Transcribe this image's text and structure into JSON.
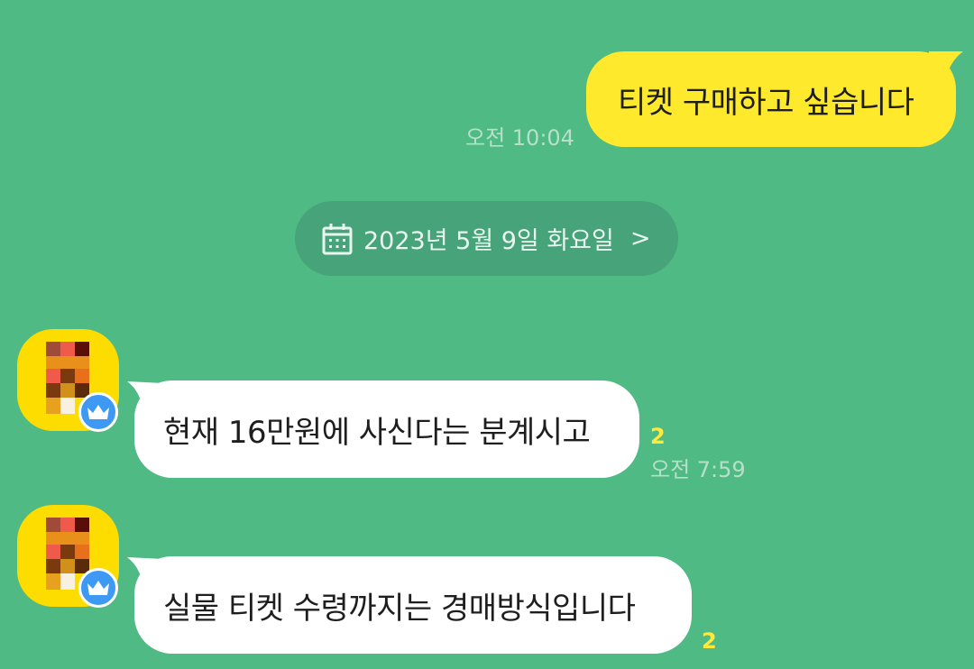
{
  "messages": {
    "outgoing_1": {
      "text": "티켓 구매하고 싶습니다",
      "time": "오전 10:04"
    },
    "date_separator": {
      "label": "2023년 5월 9일 화요일",
      "chevron": ">",
      "icon": "calendar-icon"
    },
    "incoming_1": {
      "text": "현재 16만원에 사신다는 분계시고",
      "unread": "2",
      "time": "오전 7:59"
    },
    "incoming_2": {
      "text": "실물 티켓 수령까지는 경매방식입니다",
      "unread": "2"
    }
  },
  "colors": {
    "background": "#4fba84",
    "outgoing_bubble": "#fee92c",
    "incoming_bubble": "#ffffff",
    "date_pill": "#47a37a",
    "avatar_bg": "#fddc00",
    "badge": "#3d99f4",
    "unread_count": "#ffe93a"
  }
}
